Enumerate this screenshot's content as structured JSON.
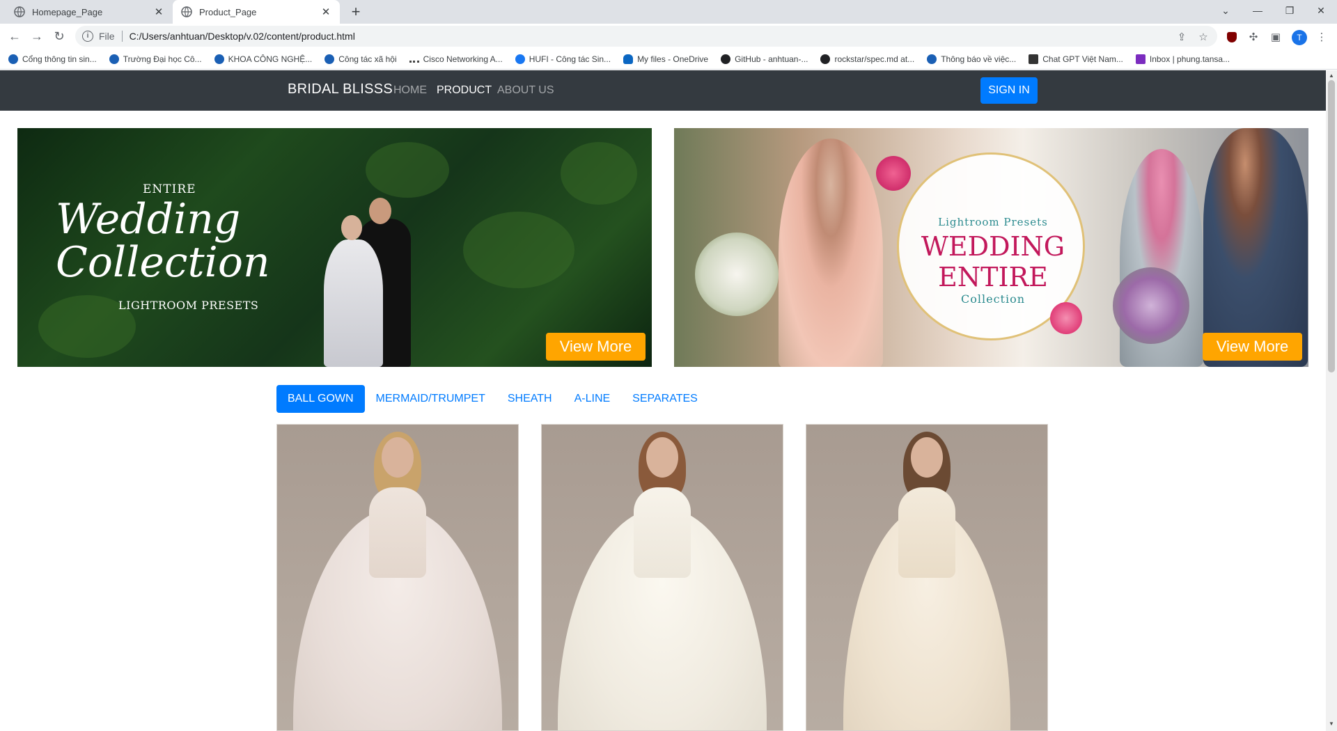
{
  "browser": {
    "tabs": [
      {
        "title": "Homepage_Page",
        "active": false
      },
      {
        "title": "Product_Page",
        "active": true
      }
    ],
    "address": {
      "scheme_label": "File",
      "url": "C:/Users/anhtuan/Desktop/v.02/content/product.html"
    },
    "profile_initial": "T",
    "bookmarks": [
      {
        "label": "Cổng thông tin sin...",
        "icon": "portal-icon"
      },
      {
        "label": "Trường Đại học Cô...",
        "icon": "portal-icon"
      },
      {
        "label": "KHOA CÔNG NGHỆ...",
        "icon": "portal-icon"
      },
      {
        "label": "Công tác xã hội",
        "icon": "portal-icon"
      },
      {
        "label": "Cisco Networking A...",
        "icon": "cisco-icon"
      },
      {
        "label": "HUFI - Công tác Sin...",
        "icon": "facebook-icon"
      },
      {
        "label": "My files - OneDrive",
        "icon": "onedrive-icon"
      },
      {
        "label": "GitHub - anhtuan-...",
        "icon": "github-icon"
      },
      {
        "label": "rockstar/spec.md at...",
        "icon": "github-icon"
      },
      {
        "label": "Thông báo về việc...",
        "icon": "portal-icon"
      },
      {
        "label": "Chat GPT Việt Nam...",
        "icon": "chatgpt-icon"
      },
      {
        "label": "Inbox | phung.tansa...",
        "icon": "mail-icon"
      }
    ]
  },
  "navbar": {
    "brand": "BRIDAL BLISSS",
    "links": [
      {
        "label": "HOME",
        "active": false
      },
      {
        "label": "PRODUCT",
        "active": true
      },
      {
        "label": "ABOUT US",
        "active": false
      }
    ],
    "signin_label": "SIGN IN"
  },
  "banners": [
    {
      "texts": {
        "entire": "ENTIRE",
        "script": "Wedding Collection",
        "presets": "LIGHTROOM PRESETS"
      },
      "button": "View More"
    },
    {
      "texts": {
        "presets": "Lightroom Presets",
        "title_line1": "WEDDING",
        "title_line2": "ENTIRE",
        "collection": "Collection"
      },
      "button": "View More"
    }
  ],
  "category_tabs": [
    {
      "label": "BALL GOWN",
      "active": true
    },
    {
      "label": "MERMAID/TRUMPET",
      "active": false
    },
    {
      "label": "SHEATH",
      "active": false
    },
    {
      "label": "A-LINE",
      "active": false
    },
    {
      "label": "SEPARATES",
      "active": false
    }
  ],
  "products": [
    {
      "image": "lace-ball-gown-photo"
    },
    {
      "image": "satin-ball-gown-photo"
    },
    {
      "image": "lace-a-line-gown-photo"
    }
  ],
  "colors": {
    "navbar_bg": "#343a40",
    "primary": "#007bff",
    "view_more": "#ffa500"
  }
}
